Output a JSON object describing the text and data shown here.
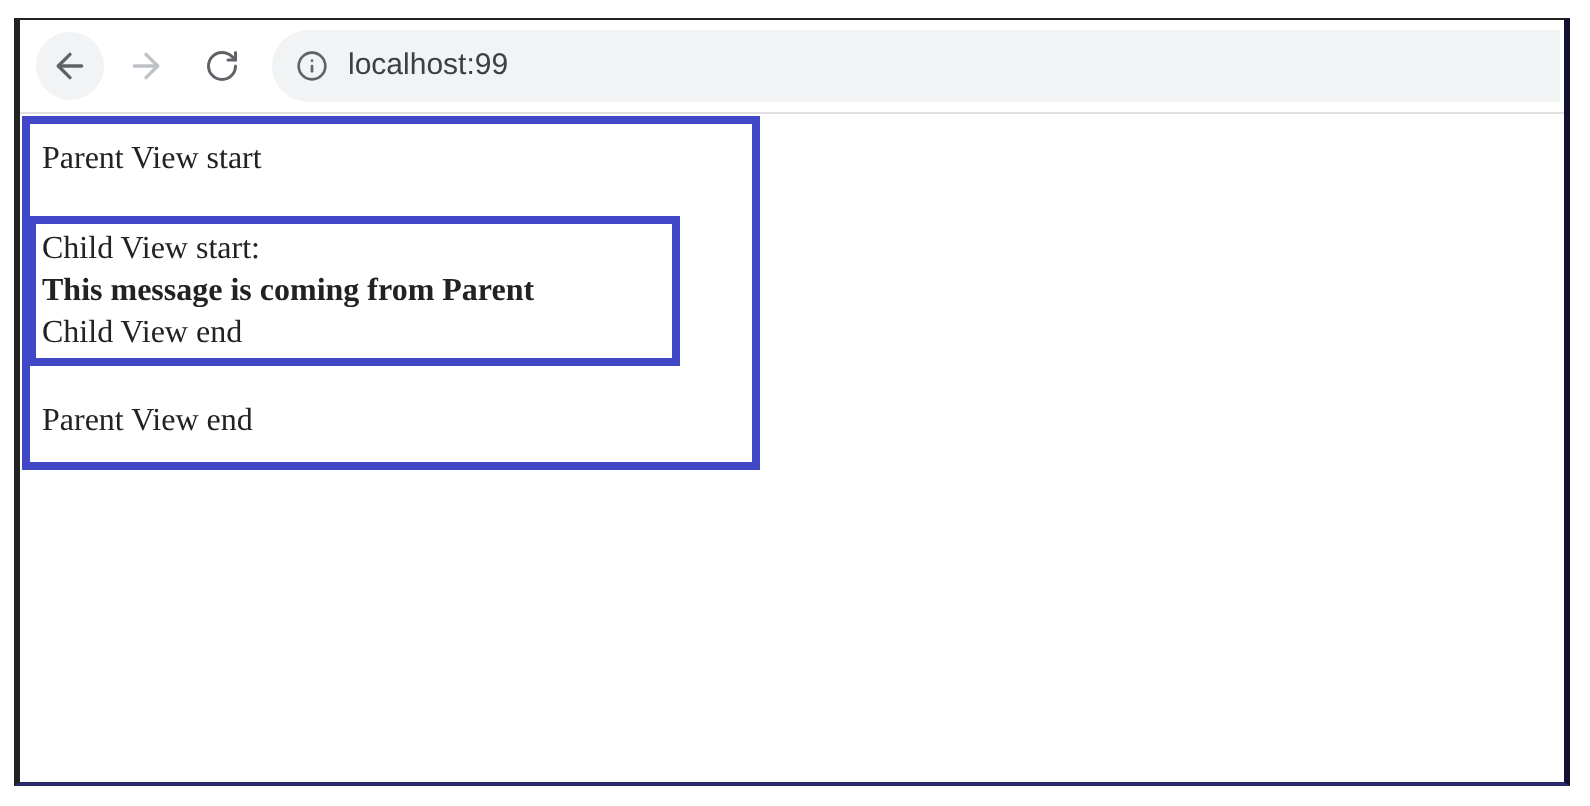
{
  "browser": {
    "address": "localhost:99"
  },
  "parent_view": {
    "start": "Parent View start",
    "child_view": {
      "start": "Child View start:",
      "message": "This message is coming from Parent",
      "end": "Child View end"
    },
    "end": "Parent View end"
  }
}
